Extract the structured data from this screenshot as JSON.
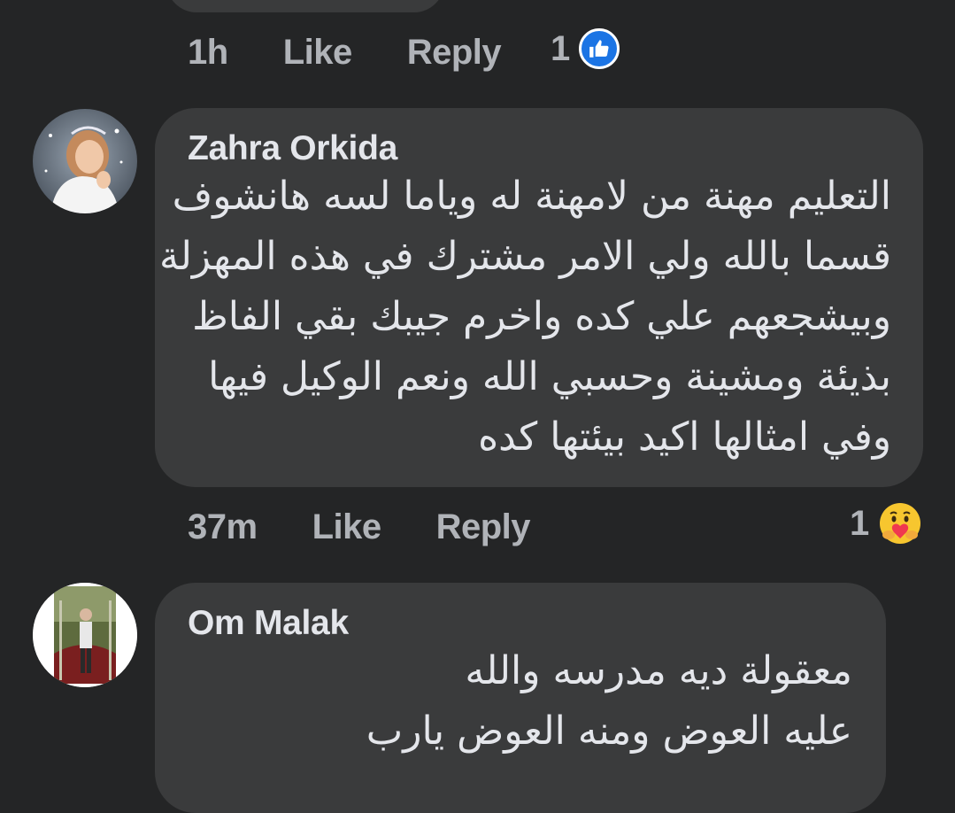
{
  "previous_comment": {
    "time": "1h",
    "like_label": "Like",
    "reply_label": "Reply",
    "reaction_count": "1",
    "reaction_icon": "like-icon"
  },
  "comments": [
    {
      "author": "Zahra Orkida",
      "lines": [
        "التعليم مهنة من لامهنة له وياما لسه هانشوف",
        "قسما بالله ولي الامر مشترك في هذه المهزلة",
        "وبيشجعهم علي كده واخرم جيبك بقي الفاظ",
        "بذيئة ومشينة وحسبي الله ونعم الوكيل فيها",
        "وفي امثالها اكيد بيئتها كده"
      ],
      "time": "37m",
      "like_label": "Like",
      "reply_label": "Reply",
      "reaction_count": "1",
      "reaction_icon": "care-icon"
    },
    {
      "author": "Om Malak",
      "lines": [
        "معقولة ديه مدرسه والله",
        "عليه العوض ومنه العوض يارب"
      ]
    }
  ],
  "colors": {
    "background": "#242526",
    "bubble": "#3a3b3c",
    "primary_text": "#e4e6eb",
    "secondary_text": "#b0b3b8",
    "like_blue": "#1b74e4",
    "care_yellow": "#f7c62f"
  }
}
